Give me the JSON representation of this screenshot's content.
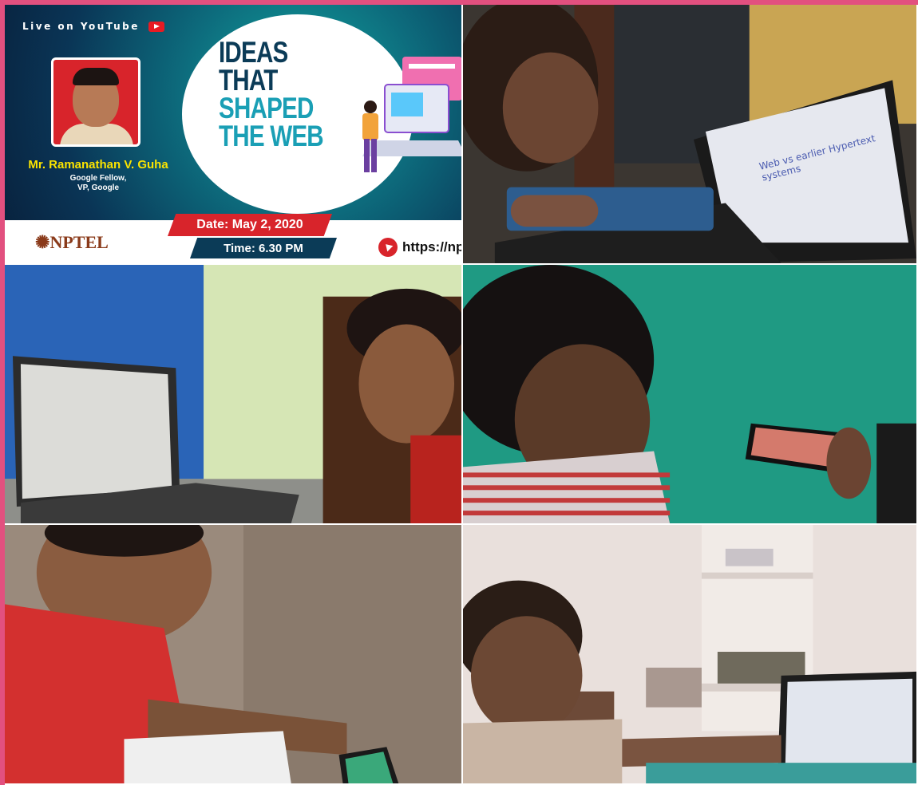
{
  "poster": {
    "live_label": "Live on YouTube",
    "speaker_name": "Mr. Ramanathan V. Guha",
    "speaker_role_1": "Google Fellow,",
    "speaker_role_2": "VP, Google",
    "headline_1": "IDEAS",
    "headline_2": "THAT",
    "headline_3": "SHAPED",
    "headline_4": "THE WEB",
    "org": "NPTEL",
    "date": "Date: May 2, 2020",
    "time": "Time: 6.30 PM",
    "url": "https://np"
  },
  "photos": {
    "laptop_slide_title": "Web vs earlier Hypertext systems"
  },
  "colors": {
    "border_pink": "#e2507f",
    "poster_red": "#d8242b",
    "poster_navy": "#0b3b57",
    "poster_yellow": "#fbe400"
  }
}
